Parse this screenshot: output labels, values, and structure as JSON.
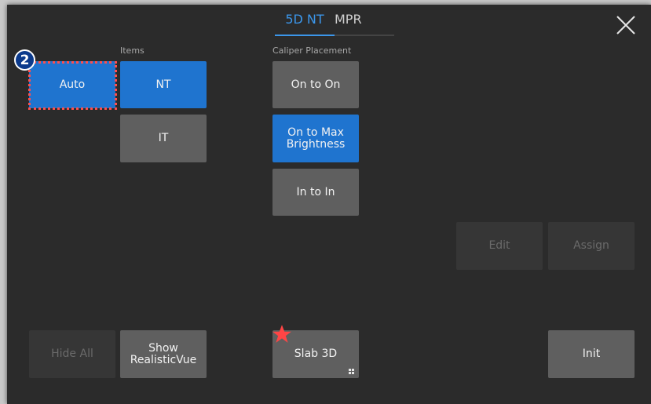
{
  "tabs": [
    {
      "label": "5D NT",
      "active": true
    },
    {
      "label": "MPR",
      "active": false
    }
  ],
  "sections": {
    "items_label": "Items",
    "caliper_label": "Caliper Placement"
  },
  "buttons": {
    "auto": "Auto",
    "nt": "NT",
    "it": "IT",
    "on_to_on": "On to On",
    "on_to_max_line1": "On to Max",
    "on_to_max_line2": "Brightness",
    "in_to_in": "In to In",
    "edit": "Edit",
    "assign": "Assign",
    "hide_all": "Hide All",
    "show_line1": "Show",
    "show_line2": "RealisticVue",
    "slab3d": "Slab 3D",
    "init": "Init"
  },
  "annotation": {
    "step_number": "2"
  },
  "colors": {
    "accent": "#1f74cf",
    "tab_active": "#3b96ea",
    "highlight": "#ff4f4f"
  }
}
